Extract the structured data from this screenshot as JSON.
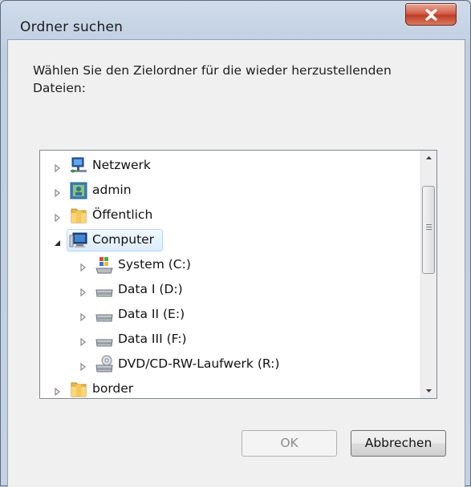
{
  "window": {
    "title": "Ordner suchen"
  },
  "instruction": "Wählen Sie den Zielordner für die wieder herzustellenden Dateien:",
  "tree": {
    "items": [
      {
        "label": "Netzwerk",
        "icon": "network-icon",
        "level": 0,
        "expanded": false,
        "selected": false
      },
      {
        "label": "admin",
        "icon": "user-folder-icon",
        "level": 0,
        "expanded": false,
        "selected": false
      },
      {
        "label": "Öffentlich",
        "icon": "folder-icon",
        "level": 0,
        "expanded": false,
        "selected": false
      },
      {
        "label": "Computer",
        "icon": "computer-icon",
        "level": 0,
        "expanded": true,
        "selected": true
      },
      {
        "label": "System (C:)",
        "icon": "system-drive-icon",
        "level": 1,
        "expanded": false,
        "selected": false
      },
      {
        "label": "Data I (D:)",
        "icon": "hard-drive-icon",
        "level": 1,
        "expanded": false,
        "selected": false
      },
      {
        "label": "Data II (E:)",
        "icon": "hard-drive-icon",
        "level": 1,
        "expanded": false,
        "selected": false
      },
      {
        "label": "Data III (F:)",
        "icon": "hard-drive-icon",
        "level": 1,
        "expanded": false,
        "selected": false
      },
      {
        "label": "DVD/CD-RW-Laufwerk (R:)",
        "icon": "dvd-drive-icon",
        "level": 1,
        "expanded": false,
        "selected": false
      },
      {
        "label": "border",
        "icon": "folder-icon",
        "level": 0,
        "expanded": false,
        "selected": false
      }
    ]
  },
  "buttons": {
    "ok": "OK",
    "cancel": "Abbrechen",
    "ok_enabled": false
  },
  "colors": {
    "selection": "#dcebfc",
    "close_button": "#c9452f"
  }
}
